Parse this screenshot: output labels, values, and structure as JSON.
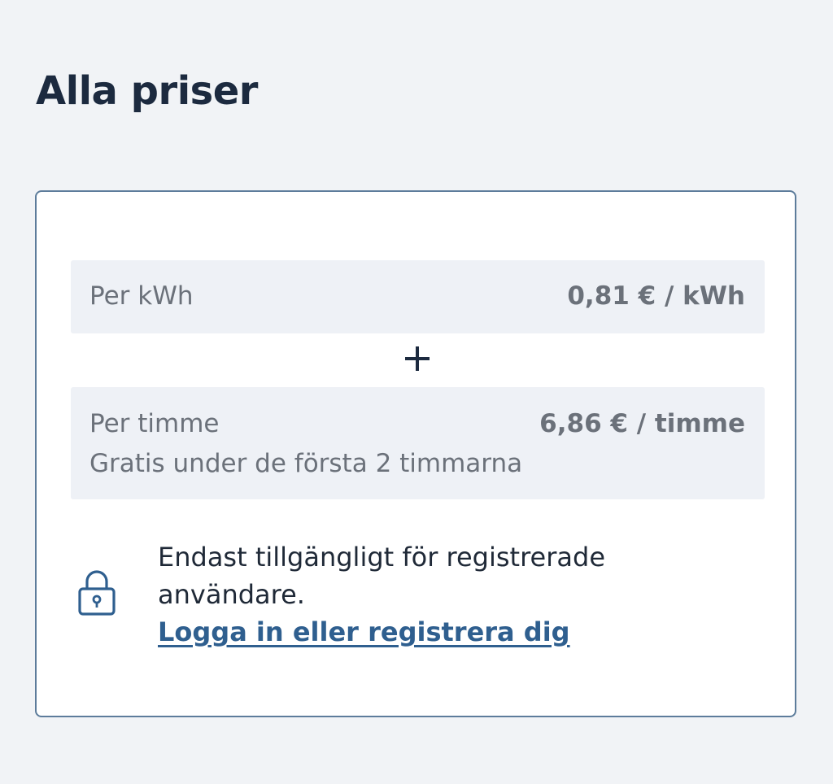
{
  "header": {
    "title": "Alla priser"
  },
  "pricing": {
    "per_kwh": {
      "label": "Per kWh",
      "value": "0,81 € / kWh"
    },
    "plus_symbol": "+",
    "per_hour": {
      "label": "Per timme",
      "value": "6,86 € / timme",
      "note": "Gratis under de första 2 timmarna"
    }
  },
  "restriction": {
    "icon": "lock-icon",
    "message_line1": "Endast tillgängligt för registrerade",
    "message_line2": "användare.",
    "login_link": "Logga in eller registrera dig"
  },
  "colors": {
    "background": "#f1f3f6",
    "card_border": "#5d7c9b",
    "row_background": "#eef1f6",
    "link": "#2f5f8f",
    "title": "#1c2a3f",
    "muted_text": "#6b717a"
  }
}
